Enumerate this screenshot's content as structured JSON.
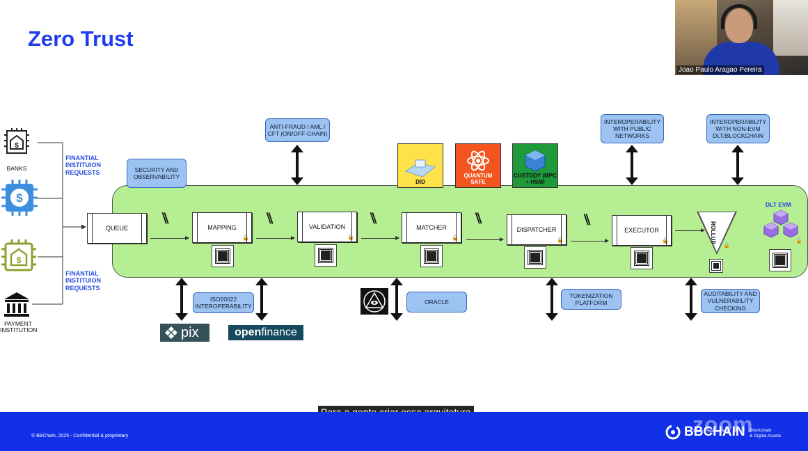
{
  "title": "Zero Trust",
  "webcam": {
    "participant_name": "Joao Paulo Aragao Pereira"
  },
  "sources": {
    "banks_label": "BANKS",
    "payment_label": "PAYMENT INSTITUTION",
    "requests_top": "FINANTIAL INSTITUION REQUESTS",
    "requests_bottom": "FINANTIAL INSTITUION REQUESTS"
  },
  "top_boxes": {
    "security": "SECURITY AND OBSERVABILITY",
    "antifraud": "ANTI-FRAUD / AML / CFT (ON/OFF-CHAIN)",
    "interop_public": "INTEROPERABILITY WITH PUBLIC NETWORKS",
    "interop_non_evm": "INTEROPERABILITY WITH NON-EVM DLT/BLOCKCHAIN"
  },
  "badges": {
    "did": "DID",
    "quantum": "QUANTUM SAFE",
    "custody": "CUSTODY (MPC + HSM)"
  },
  "pipeline": {
    "queue": "QUEUE",
    "mapping": "MAPPING",
    "validation": "VALIDATION",
    "matcher": "MATCHER",
    "dispatcher": "DISPATCHER",
    "executor": "EXECUTOR",
    "rollup": "ROLLUP",
    "dlt": "DLT EVM"
  },
  "bottom_boxes": {
    "iso": "ISO20022 INTEROPERABILITY",
    "oracle": "ORACLE",
    "tokenization": "TOKENIZATION PLATFORM",
    "audit": "AUDITABILITY AND VULNERABILITY CHECKING"
  },
  "logos": {
    "pix": "pix",
    "open": "open",
    "finance": "finance"
  },
  "caption": "Para a gente criar essa arquitetura",
  "footer": {
    "copyright": "© BBChain, 2025 - Confidential & proprietary",
    "brand": "BBCHAIN",
    "brand_sub_1": "Blockchain",
    "brand_sub_2": "& Digital Assets",
    "zoom": "zoom"
  },
  "colors": {
    "title": "#1f3cf0",
    "footer": "#1230e8",
    "banner": "#b6ee93",
    "box": "#9cc3f2"
  }
}
